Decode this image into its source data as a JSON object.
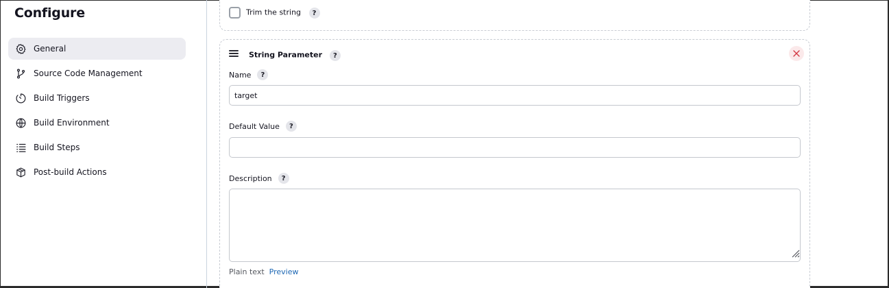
{
  "sidebar": {
    "title": "Configure",
    "items": [
      {
        "label": "General",
        "icon": "gear-icon",
        "active": true
      },
      {
        "label": "Source Code Management",
        "icon": "branch-icon",
        "active": false
      },
      {
        "label": "Build Triggers",
        "icon": "timer-icon",
        "active": false
      },
      {
        "label": "Build Environment",
        "icon": "globe-icon",
        "active": false
      },
      {
        "label": "Build Steps",
        "icon": "list-icon",
        "active": false
      },
      {
        "label": "Post-build Actions",
        "icon": "package-icon",
        "active": false
      }
    ]
  },
  "trim": {
    "label": "Trim the string",
    "checked": false,
    "help": "?"
  },
  "string_parameter": {
    "title": "String Parameter",
    "help": "?",
    "name": {
      "label": "Name",
      "value": "target",
      "help": "?"
    },
    "default_value": {
      "label": "Default Value",
      "value": "",
      "help": "?"
    },
    "description": {
      "label": "Description",
      "value": "",
      "help": "?"
    },
    "format": {
      "plain_text": "Plain text",
      "preview": "Preview"
    }
  },
  "colors": {
    "accent_link": "#1d67b4",
    "active_nav_bg": "#ececf1",
    "close_bg": "#fbe9ea",
    "close_x": "#d33a45"
  }
}
